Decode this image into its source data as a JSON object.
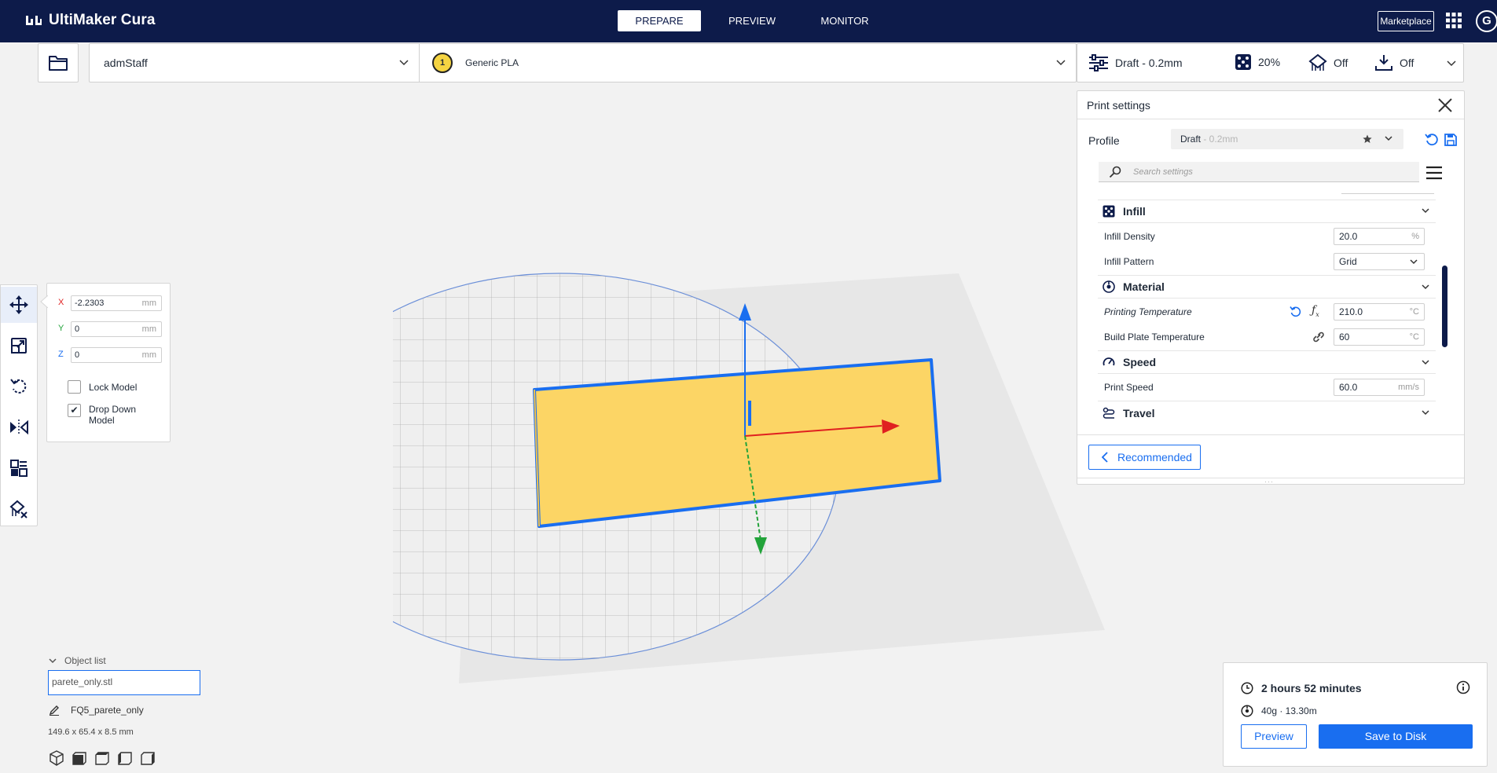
{
  "app": {
    "title": "UltiMaker Cura",
    "logo_icon": "ultimaker-logo-icon"
  },
  "stages": [
    {
      "label": "PREPARE",
      "active": true
    },
    {
      "label": "PREVIEW",
      "active": false
    },
    {
      "label": "MONITOR",
      "active": false
    }
  ],
  "header": {
    "marketplace_label": "Marketplace",
    "account_initial": "G"
  },
  "printer": {
    "name": "admStaff"
  },
  "material": {
    "extruder_number": "1",
    "name": "Generic PLA"
  },
  "settings_bar": {
    "profile": "Draft - 0.2mm",
    "infill": "20%",
    "support": "Off",
    "adhesion": "Off"
  },
  "print_settings": {
    "title": "Print settings",
    "profile_label": "Profile",
    "profile_name": "Draft",
    "profile_sub": " - 0.2mm",
    "search_placeholder": "Search settings",
    "categories": {
      "infill": "Infill",
      "material": "Material",
      "speed": "Speed",
      "travel": "Travel"
    },
    "settings": {
      "infill_density": {
        "label": "Infill Density",
        "value": "20.0",
        "unit": "%"
      },
      "infill_pattern": {
        "label": "Infill Pattern",
        "value": "Grid"
      },
      "printing_temperature": {
        "label": "Printing Temperature",
        "value": "210.0",
        "unit": "°C"
      },
      "build_plate_temperature": {
        "label": "Build Plate Temperature",
        "value": "60",
        "unit": "°C"
      },
      "print_speed": {
        "label": "Print Speed",
        "value": "60.0",
        "unit": "mm/s"
      }
    },
    "recommended_label": "Recommended"
  },
  "move_tool": {
    "x": {
      "label": "X",
      "value": "-2.2303",
      "unit": "mm"
    },
    "y": {
      "label": "Y",
      "value": "0",
      "unit": "mm"
    },
    "z": {
      "label": "Z",
      "value": "0",
      "unit": "mm"
    },
    "lock_model": {
      "label": "Lock Model",
      "checked": false
    },
    "drop_down_model": {
      "label": "Drop Down Model",
      "checked": true
    }
  },
  "object_list": {
    "toggle_label": "Object list",
    "object_name": "parete_only.stl",
    "job_name": "FQ5_parete_only",
    "dimensions": "149.6 x 65.4 x 8.5 mm"
  },
  "action_panel": {
    "print_time": "2 hours 52 minutes",
    "material_estimate": "40g · 13.30m",
    "preview_label": "Preview",
    "save_label": "Save to Disk"
  },
  "colors": {
    "header_bg": "#0d1b4a",
    "accent": "#196ef0",
    "model_fill": "#fcd565",
    "axis_x": "#e02020",
    "axis_y": "#22a33a",
    "axis_z": "#196ef0"
  }
}
